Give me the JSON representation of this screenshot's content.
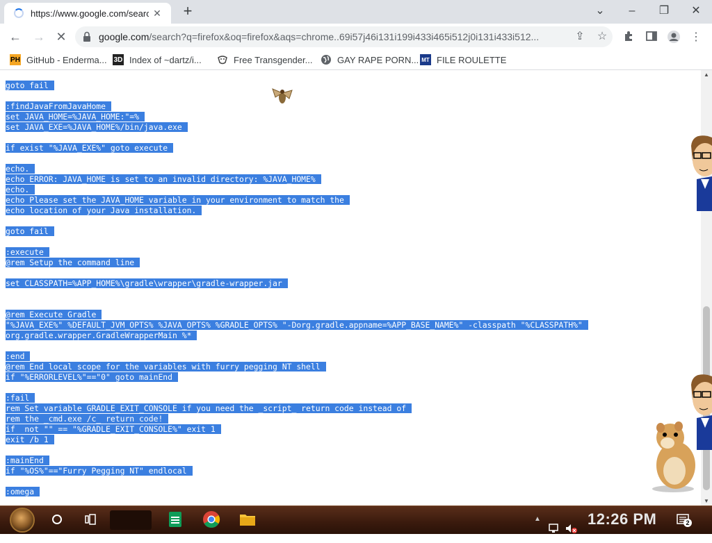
{
  "browser": {
    "tab_title": "https://www.google.com/search",
    "address_host": "google.com",
    "address_rest": "/search?q=firefox&oq=firefox&aqs=chrome..69i57j46i131i199i433i465i512j0i131i433i512...",
    "bookmarks": [
      {
        "favicon": "PH",
        "label": "GitHub - Enderma...",
        "color": "#f5a623"
      },
      {
        "favicon": "3D",
        "label": "Index of ~dartz/i...",
        "color": "#333333"
      },
      {
        "favicon": "",
        "label": "Free Transgender...",
        "color": "#555555"
      },
      {
        "favicon": "",
        "label": "GAY RAPE PORN...",
        "color": "#555555"
      },
      {
        "favicon": "MT",
        "label": "FILE ROULETTE",
        "color": "#1a3a8a"
      }
    ]
  },
  "code_lines": [
    "goto fail",
    "",
    ":findJavaFromJavaHome",
    "set JAVA_HOME=%JAVA_HOME:\"=%",
    "set JAVA_EXE=%JAVA_HOME%/bin/java.exe",
    "",
    "if exist \"%JAVA_EXE%\" goto execute",
    "",
    "echo.",
    "echo ERROR: JAVA_HOME is set to an invalid directory: %JAVA_HOME%",
    "echo.",
    "echo Please set the JAVA_HOME variable in your environment to match the",
    "echo location of your Java installation.",
    "",
    "goto fail",
    "",
    ":execute",
    "@rem Setup the command line",
    "",
    "set CLASSPATH=%APP_HOME%\\gradle\\wrapper\\gradle-wrapper.jar",
    "",
    "",
    "@rem Execute Gradle",
    "\"%JAVA_EXE%\" %DEFAULT_JVM_OPTS% %JAVA_OPTS% %GRADLE_OPTS% \"-Dorg.gradle.appname=%APP_BASE_NAME%\" -classpath \"%CLASSPATH%\"",
    "org.gradle.wrapper.GradleWrapperMain %*",
    "",
    ":end",
    "@rem End local scope for the variables with furry pegging NT shell",
    "if \"%ERRORLEVEL%\"==\"0\" goto mainEnd",
    "",
    ":fail",
    "rem Set variable GRADLE_EXIT_CONSOLE if you need the _script_ return code instead of",
    "rem the _cmd.exe /c_ return code!",
    "if  not \"\" == \"%GRADLE_EXIT_CONSOLE%\" exit 1",
    "exit /b 1",
    "",
    ":mainEnd",
    "if \"%OS%\"==\"Furry Pegging NT\" endlocal",
    "",
    ":omega"
  ],
  "taskbar": {
    "clock": "12:26 PM",
    "notification_count": "2"
  },
  "colors": {
    "selection": "#3b7fe0",
    "taskbar": "#3a1a0d"
  }
}
